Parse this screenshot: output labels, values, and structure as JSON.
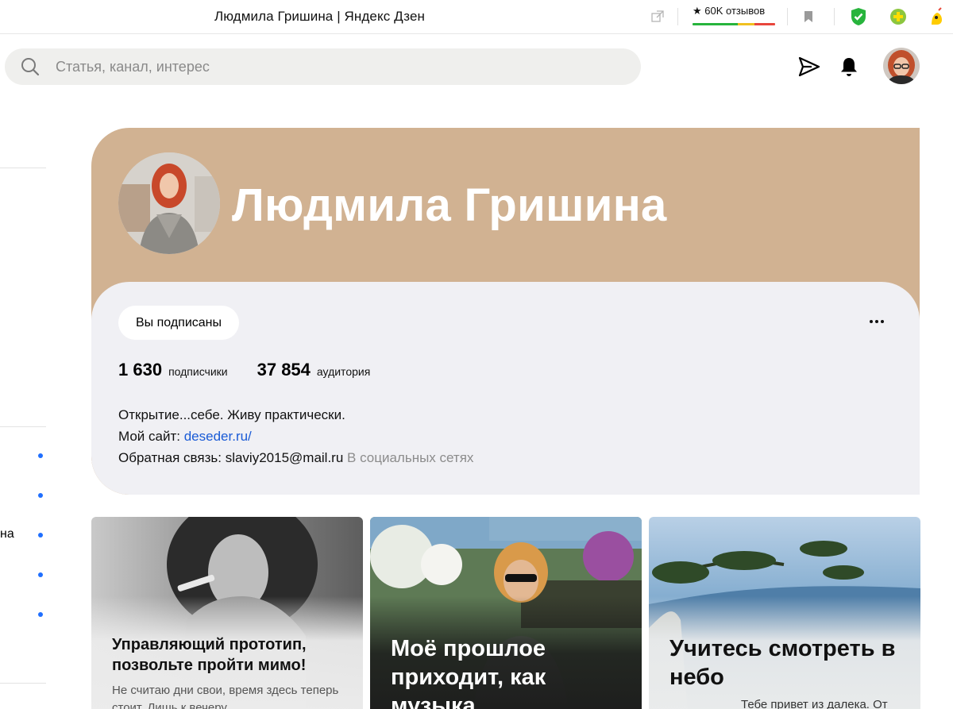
{
  "browser": {
    "tab_title": "Людмила Гришина | Яндекс Дзен",
    "reviews_label": "★ 60K отзывов",
    "icons": [
      "external-link-icon",
      "bookmark-icon",
      "shield-check-icon",
      "green-plus-extension-icon",
      "yellow-extension-icon"
    ],
    "colors": {
      "shield": "#27b43c",
      "plus_ext": "#8cc63f",
      "yellow_ext": "#ffcc00"
    }
  },
  "header": {
    "search_placeholder": "Статья, канал, интерес",
    "icons": [
      "search-icon",
      "send-icon",
      "bell-icon",
      "avatar"
    ]
  },
  "sidebar": {
    "visible_fragment": "на",
    "dot_color": "#1f6fff"
  },
  "channel": {
    "name": "Людмила Гришина",
    "banner_color": "#d1b292",
    "panel_color": "#f0f0f4",
    "subscribe_label": "Вы подписаны",
    "subscribers_value": "1 630",
    "subscribers_label": "подписчики",
    "audience_value": "37 854",
    "audience_label": "аудитория",
    "description_line": "Открытие...себе. Живу практически.",
    "site_prefix": "Мой сайт: ",
    "site_link": "deseder.ru/",
    "feedback_text": "Обратная связь: slaviy2015@mail.ru",
    "social_link": "В социальных сетях",
    "link_color": "#1a5bd6"
  },
  "articles": [
    {
      "title": "Управляющий прототип, позвольте пройти мимо!",
      "snippet": "Не считаю дни свои, время здесь теперь стоит. Лишь к вечеру"
    },
    {
      "title": "Моё прошлое приходит, как музыка"
    },
    {
      "title": "Учитесь смотреть в небо",
      "snippet": "Тебе привет из далека. От"
    }
  ]
}
